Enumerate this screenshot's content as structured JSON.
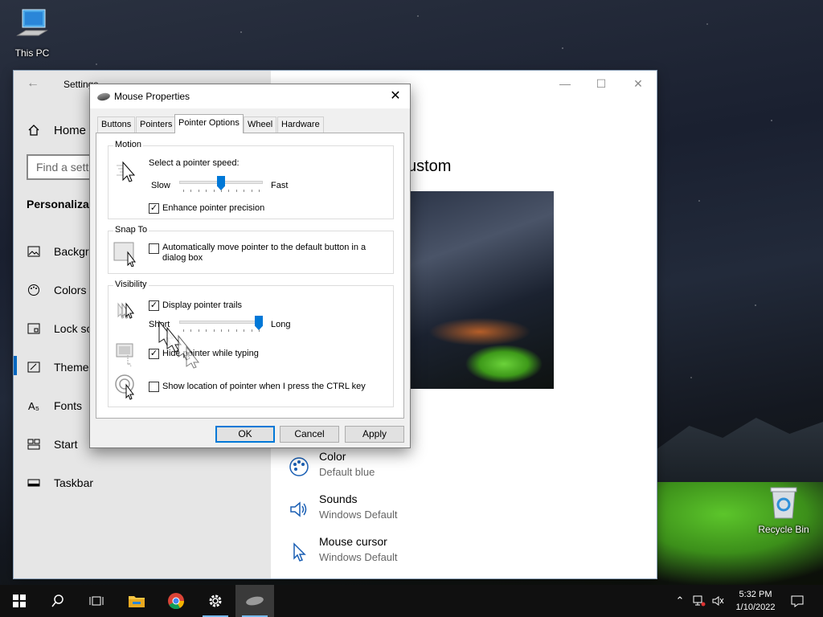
{
  "desktop": {
    "icons": [
      {
        "label": "This PC",
        "icon": "computer-icon"
      },
      {
        "label": "Recycle Bin",
        "icon": "recycle-bin-icon"
      }
    ]
  },
  "settings": {
    "title": "Settings",
    "home_label": "Home",
    "search_placeholder": "Find a setti",
    "section_title": "Personalizati",
    "nav_items": [
      {
        "label": "Backgro",
        "icon": "picture-icon"
      },
      {
        "label": "Colors",
        "icon": "palette-icon"
      },
      {
        "label": "Lock scr",
        "icon": "lock-screen-icon"
      },
      {
        "label": "Themes",
        "icon": "themes-icon",
        "active": true
      },
      {
        "label": "Fonts",
        "icon": "fonts-icon"
      },
      {
        "label": "Start",
        "icon": "start-icon"
      },
      {
        "label": "Taskbar",
        "icon": "taskbar-icon"
      }
    ],
    "main": {
      "current_theme_fragment": "ustom",
      "items": [
        {
          "name": "Color",
          "value": "Default blue",
          "icon": "palette-icon"
        },
        {
          "name": "Sounds",
          "value": "Windows Default",
          "icon": "speaker-icon"
        },
        {
          "name": "Mouse cursor",
          "value": "Windows Default",
          "icon": "cursor-icon"
        }
      ]
    }
  },
  "mouse_dialog": {
    "title": "Mouse Properties",
    "tabs": [
      "Buttons",
      "Pointers",
      "Pointer Options",
      "Wheel",
      "Hardware"
    ],
    "active_tab": "Pointer Options",
    "motion": {
      "group_label": "Motion",
      "prompt": "Select a pointer speed:",
      "slow_label": "Slow",
      "fast_label": "Fast",
      "speed_level": 0.5,
      "precision_label": "Enhance pointer precision",
      "precision_checked": true
    },
    "snap_to": {
      "group_label": "Snap To",
      "label_line1": "Automatically move pointer to the default button in a",
      "label_line2": "dialog box",
      "checked": false
    },
    "visibility": {
      "group_label": "Visibility",
      "trails_label": "Display pointer trails",
      "trails_checked": true,
      "short_label": "Short",
      "long_label": "Long",
      "trail_length_level": 1.0,
      "hide_label": "Hide pointer while typing",
      "hide_checked": true,
      "ctrl_label": "Show location of pointer when I press the CTRL key",
      "ctrl_checked": false
    },
    "buttons": {
      "ok": "OK",
      "cancel": "Cancel",
      "apply": "Apply"
    }
  },
  "taskbar": {
    "clock_time": "5:32 PM",
    "clock_date": "1/10/2022",
    "apps": [
      "start-icon",
      "search-icon",
      "task-view-icon",
      "file-explorer-icon",
      "chrome-icon",
      "settings-icon",
      "mouse-icon"
    ]
  },
  "colors": {
    "accent": "#0078d7",
    "tent_green": "#5cc52b"
  }
}
